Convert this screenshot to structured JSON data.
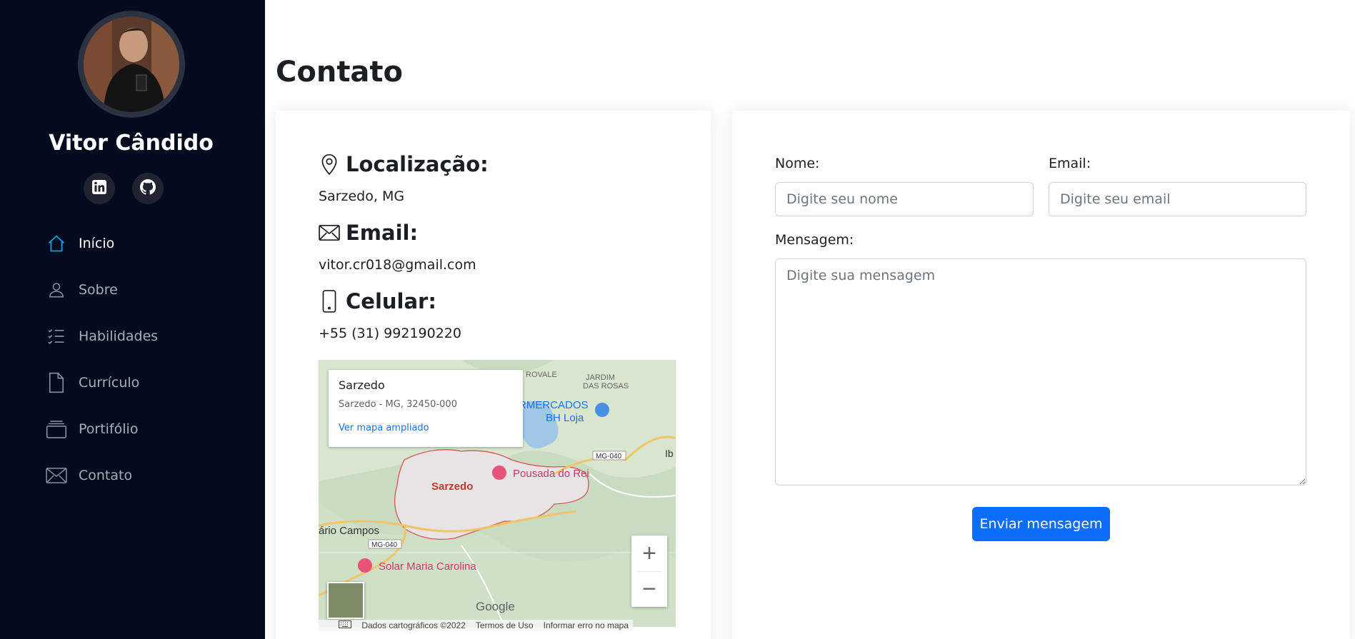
{
  "sidebar": {
    "name": "Vitor Cândido",
    "social": [
      {
        "icon": "linkedin-icon"
      },
      {
        "icon": "github-icon"
      }
    ],
    "nav": [
      {
        "label": "Início",
        "icon": "home-icon",
        "active": true
      },
      {
        "label": "Sobre",
        "icon": "person-icon",
        "active": false
      },
      {
        "label": "Habilidades",
        "icon": "list-check-icon",
        "active": false
      },
      {
        "label": "Currículo",
        "icon": "file-icon",
        "active": false
      },
      {
        "label": "Portifólio",
        "icon": "collection-icon",
        "active": false
      },
      {
        "label": "Contato",
        "icon": "envelope-icon",
        "active": false
      }
    ]
  },
  "main": {
    "title": "Contato"
  },
  "info": {
    "location_label": "Localização:",
    "location_value": "Sarzedo, MG",
    "email_label": "Email:",
    "email_value": "vitor.cr018@gmail.com",
    "phone_label": "Celular:",
    "phone_value": "+55 (31) 992190220"
  },
  "map": {
    "popup_title": "Sarzedo",
    "popup_address": "Sarzedo - MG, 32450-000",
    "popup_link": "Ver mapa ampliado",
    "labels": {
      "sarzedo": "Sarzedo",
      "pousada": "Pousada do Rei",
      "solar": "Solar Maria Carolina",
      "campos": "ário Campos",
      "supermercados": "RMERCADOS",
      "bh_loja": "BH Loja",
      "jardim": "JARDIM",
      "das_rosas": "DAS ROSAS",
      "rovale": "ROVALE",
      "ib": "Ib",
      "mg040_a": "MG-040",
      "mg040_b": "MG-040",
      "google": "Google"
    },
    "zoom_in": "+",
    "zoom_out": "−",
    "footer": {
      "data": "Dados cartográficos ©2022",
      "terms": "Termos de Uso",
      "report": "Informar erro no mapa"
    }
  },
  "form": {
    "name_label": "Nome:",
    "name_placeholder": "Digite seu nome",
    "email_label": "Email:",
    "email_placeholder": "Digite seu email",
    "message_label": "Mensagem:",
    "message_placeholder": "Digite sua mensagem",
    "submit_label": "Enviar mensagem"
  },
  "colors": {
    "sidebar_bg": "#040b1f",
    "active_icon": "#149ddd",
    "button": "#0d6efd"
  }
}
